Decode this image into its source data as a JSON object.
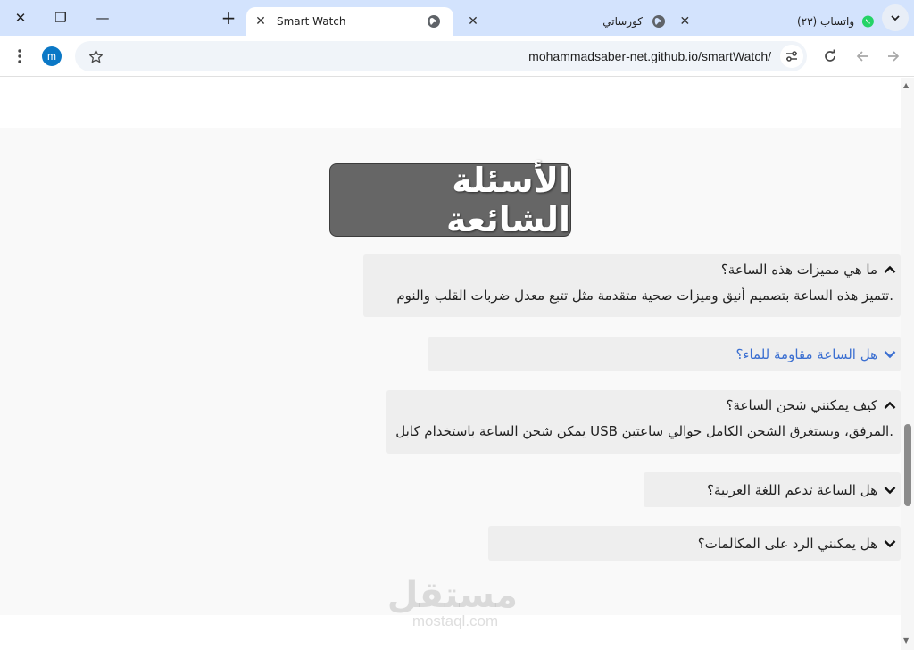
{
  "tabs": [
    {
      "title": "Smart Watch",
      "active": true
    },
    {
      "title": "كورساتي",
      "active": false
    },
    {
      "title": "(٢٣) واتساب",
      "active": false
    }
  ],
  "window_controls": {
    "close": "✕",
    "restore": "❐",
    "minimize": "—"
  },
  "new_tab": "+",
  "address_bar": {
    "url": "mohammadsaber-net.github.io/smartWatch/"
  },
  "profile": {
    "initial": "m",
    "color": "#0b78c6"
  },
  "page": {
    "faq_title": "الأسئلة الشائعة",
    "faqs": [
      {
        "question": "ما هي مميزات هذه الساعة؟",
        "answer": ".تتميز هذه الساعة بتصميم أنيق وميزات صحية متقدمة مثل تتبع معدل ضربات القلب والنوم",
        "expanded": true
      },
      {
        "question": "هل الساعة مقاومة للماء؟",
        "answer": "",
        "expanded": false
      },
      {
        "question": "كيف يمكنني شحن الساعة؟",
        "answer": ".المرفق، ويستغرق الشحن الكامل حوالي ساعتين USB يمكن شحن الساعة باستخدام كابل",
        "expanded": true
      },
      {
        "question": "هل الساعة تدعم اللغة العربية؟",
        "answer": "",
        "expanded": false
      },
      {
        "question": "هل يمكنني الرد على المكالمات؟",
        "answer": "",
        "expanded": false
      }
    ]
  },
  "watermark": {
    "arabic": "مستقل",
    "latin": "mostaql.com"
  },
  "colors": {
    "tabstrip": "#d3e3fd",
    "heading_bg": "#666666",
    "link": "#3b6fd1",
    "faq_bg": "#eeeeee"
  }
}
